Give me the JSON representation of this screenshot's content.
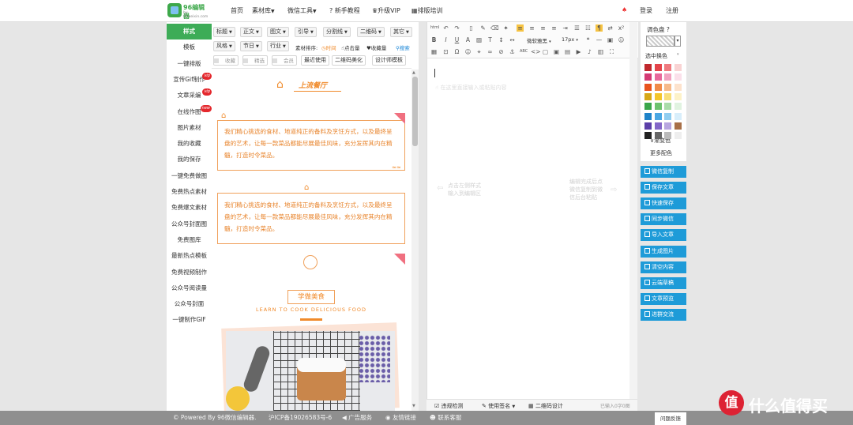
{
  "nav": {
    "home": "首页",
    "materials": "素材库",
    "wechat_tools": "微信工具",
    "tutorial": "新手教程",
    "upgrade": "升级VIP",
    "training": "排版培训",
    "login": "登录",
    "register": "注册"
  },
  "logo": {
    "title": "96编辑器",
    "subtitle": "by 96weixin.com"
  },
  "sidebar": {
    "items": [
      {
        "label": "样式"
      },
      {
        "label": "模板"
      },
      {
        "label": "一键排版"
      },
      {
        "label": "宣传Gif制作",
        "badge": "vip"
      },
      {
        "label": "文章采编",
        "badge": "vip"
      },
      {
        "label": "在线作图",
        "badge": "new"
      },
      {
        "label": "图片素材"
      },
      {
        "label": "我的收藏"
      },
      {
        "label": "我的保存"
      },
      {
        "label": "一键免费做图"
      },
      {
        "label": "免费热点素材"
      },
      {
        "label": "免费爆文素材"
      },
      {
        "label": "公众号封面图"
      },
      {
        "label": "免费图库"
      },
      {
        "label": "最新热点模板"
      },
      {
        "label": "免费视频制作"
      },
      {
        "label": "公众号阅读量"
      },
      {
        "label": "公众号封面"
      },
      {
        "label": "一键制作GIF"
      }
    ]
  },
  "style_toolbar": {
    "row1": [
      "标题",
      "正文",
      "图文",
      "引导",
      "分割线",
      "二维码",
      "其它"
    ],
    "row2": [
      "风格",
      "节日",
      "行业"
    ],
    "sort_label": "素材排序:",
    "sort_time": "时间",
    "sort_clicks": "点击量",
    "sort_favs": "收藏量",
    "search": "搜索",
    "row3_checks": [
      "收藏",
      "精选",
      "会员"
    ],
    "row3_buttons": [
      "最近使用",
      "二维码美化",
      "设计师模板"
    ]
  },
  "preview": {
    "header_title": "上流餐厅",
    "block_text": "我们精心挑选的食材、地道纯正的备料及烹饪方式，以及最终呈盘的艺术，让每一款菜品都能尽展最佳风味，充分发挥其内在精髓，打造时令菜品。",
    "cook_title": "学做美食",
    "cook_subtitle": "LEARN TO COOK DELICIOUS FOOD"
  },
  "editor": {
    "placeholder": "在这里直接输入或粘贴内容",
    "font_name": "微软雅黑",
    "font_size": "17px",
    "hint_left_1": "点击左侧样式",
    "hint_left_2": "输入到编辑区",
    "hint_right_1": "编辑完成后点",
    "hint_right_2": "微信复制到微",
    "hint_right_3": "信后台粘贴",
    "bottom_check": "违规检测",
    "bottom_signature": "使用签名",
    "bottom_qrcode": "二维码设计",
    "bottom_count": "已输入0字0图"
  },
  "palette": {
    "title": "调色盘",
    "select_color": "选中换色",
    "gradient": "渐变色",
    "more": "更多配色",
    "colors": [
      "#c0282d",
      "#e4444a",
      "#ef7a7f",
      "#f9d3d3",
      "#d43a73",
      "#e8689a",
      "#f2a2c0",
      "#fbe0ea",
      "#e8531d",
      "#f08a48",
      "#f6b98a",
      "#fde2cc",
      "#d7a716",
      "#f3c52b",
      "#f8df7a",
      "#fdf2c8",
      "#3aa64a",
      "#6cc26e",
      "#a9dca9",
      "#e0f3e0",
      "#1f83c9",
      "#4aa7e3",
      "#90cdf0",
      "#d8eefb",
      "#5b3fa8",
      "#8467c8",
      "#b8a6e0",
      "#a87048",
      "#222222",
      "#666666",
      "#bbbbbb",
      "#eeeeee"
    ]
  },
  "actions": [
    "微信复制",
    "保存文章",
    "快速保存",
    "同步微信",
    "导入文章",
    "生成图片",
    "清空内容",
    "云端草稿",
    "文章预览",
    "进群交流"
  ],
  "footer": {
    "powered": "© Powered By 96微信编辑器.",
    "icp": "沪ICP备19026583号-6",
    "ads": "广告服务",
    "links": "友情链接",
    "contact": "联系客服",
    "feedback": "问题反馈"
  },
  "watermark": {
    "logo": "值",
    "text": "什么值得买"
  }
}
